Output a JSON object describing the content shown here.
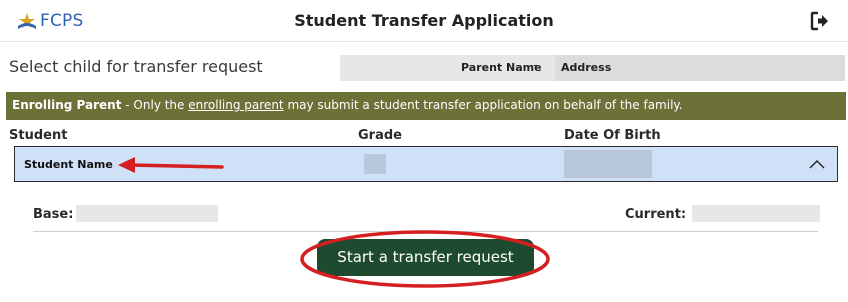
{
  "header": {
    "logo_text": "FCPS",
    "title": "Student Transfer Application",
    "logout_icon": "logout-icon"
  },
  "select_row": {
    "label": "Select child for transfer request",
    "parent_name": "Parent Name",
    "separator": "-",
    "address": "Address"
  },
  "banner": {
    "bold_prefix": "Enrolling Parent",
    "text_before_link": " - Only the ",
    "link_text": "enrolling parent",
    "text_after_link": " may submit a student transfer application on behalf of the family.",
    "background_color": "#6c7138"
  },
  "table": {
    "headers": [
      "Student",
      "Grade",
      "Date Of Birth"
    ]
  },
  "student": {
    "name": "Student Name",
    "expanded_icon": "chevron-up-icon",
    "row_color": "#cfe0f7"
  },
  "details": {
    "base_label": "Base:",
    "current_label": "Current:"
  },
  "actions": {
    "start_transfer_label": "Start a transfer request",
    "button_color": "#1e4b30"
  },
  "annotations": {
    "highlight_color": "#d42020"
  }
}
